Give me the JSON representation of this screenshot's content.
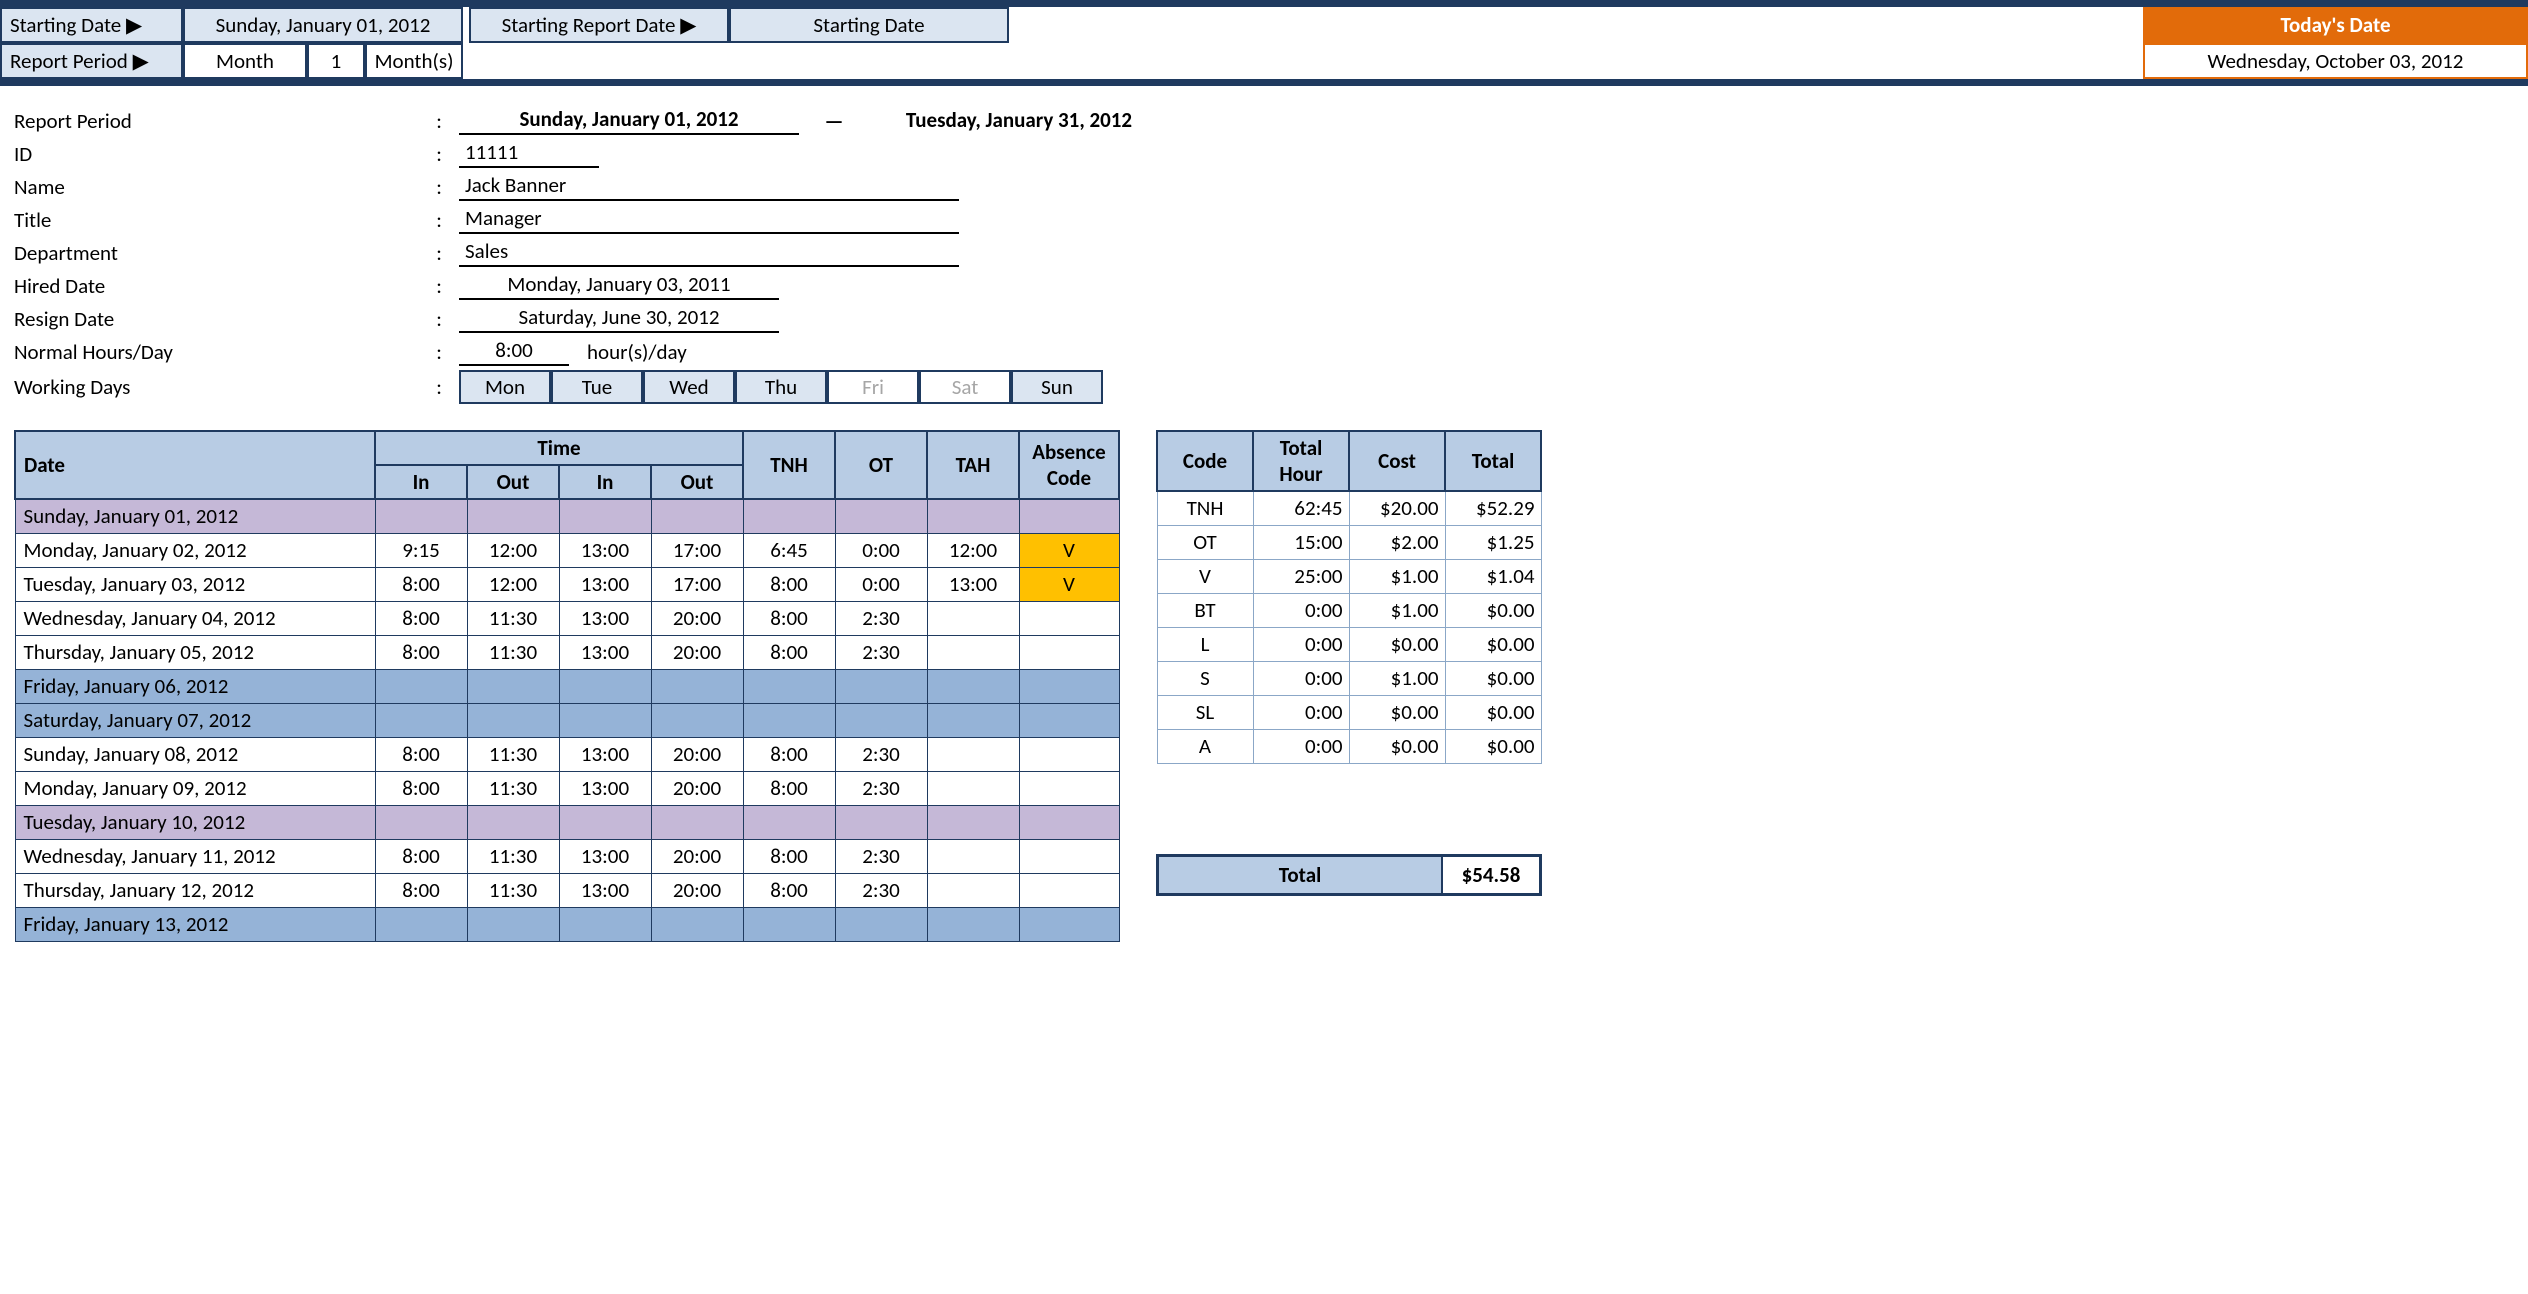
{
  "header": {
    "starting_date_label": "Starting Date ▶",
    "starting_date_value": "Sunday, January 01, 2012",
    "report_period_label": "Report Period ▶",
    "report_unit": "Month",
    "report_count": "1",
    "report_units": "Month(s)",
    "starting_report_label": "Starting Report Date ▶",
    "starting_report_value": "Starting Date",
    "todays_date_label": "Today's Date",
    "todays_date_value": "Wednesday, October 03, 2012"
  },
  "info": {
    "report_period_label": "Report Period",
    "report_start": "Sunday, January 01, 2012",
    "report_dash": "—",
    "report_end": "Tuesday, January 31, 2012",
    "id_label": "ID",
    "id_value": "11111",
    "name_label": "Name",
    "name_value": "Jack Banner",
    "title_label": "Title",
    "title_value": "Manager",
    "dept_label": "Department",
    "dept_value": "Sales",
    "hired_label": "Hired Date",
    "hired_value": "Monday, January 03, 2011",
    "resign_label": "Resign Date",
    "resign_value": "Saturday, June 30, 2012",
    "normal_label": "Normal Hours/Day",
    "normal_value": "8:00",
    "normal_unit": "hour(s)/day",
    "working_label": "Working Days",
    "days": [
      "Mon",
      "Tue",
      "Wed",
      "Thu",
      "Fri",
      "Sat",
      "Sun"
    ],
    "days_off": [
      false,
      false,
      false,
      false,
      true,
      true,
      false
    ]
  },
  "timesheet": {
    "headers": {
      "date": "Date",
      "time": "Time",
      "in": "In",
      "out": "Out",
      "tnh": "TNH",
      "ot": "OT",
      "tah": "TAH",
      "abs": "Absence Code"
    },
    "rows": [
      {
        "date": "Sunday, January 01, 2012",
        "in1": "",
        "out1": "",
        "in2": "",
        "out2": "",
        "tnh": "",
        "ot": "",
        "tah": "",
        "abs": "",
        "style": "purple"
      },
      {
        "date": "Monday, January 02, 2012",
        "in1": "9:15",
        "out1": "12:00",
        "in2": "13:00",
        "out2": "17:00",
        "tnh": "6:45",
        "ot": "0:00",
        "tah": "12:00",
        "abs": "V",
        "style": ""
      },
      {
        "date": "Tuesday, January 03, 2012",
        "in1": "8:00",
        "out1": "12:00",
        "in2": "13:00",
        "out2": "17:00",
        "tnh": "8:00",
        "ot": "0:00",
        "tah": "13:00",
        "abs": "V",
        "style": ""
      },
      {
        "date": "Wednesday, January 04, 2012",
        "in1": "8:00",
        "out1": "11:30",
        "in2": "13:00",
        "out2": "20:00",
        "tnh": "8:00",
        "ot": "2:30",
        "tah": "",
        "abs": "",
        "style": ""
      },
      {
        "date": "Thursday, January 05, 2012",
        "in1": "8:00",
        "out1": "11:30",
        "in2": "13:00",
        "out2": "20:00",
        "tnh": "8:00",
        "ot": "2:30",
        "tah": "",
        "abs": "",
        "style": ""
      },
      {
        "date": "Friday, January 06, 2012",
        "in1": "",
        "out1": "",
        "in2": "",
        "out2": "",
        "tnh": "",
        "ot": "",
        "tah": "",
        "abs": "",
        "style": "blue"
      },
      {
        "date": "Saturday, January 07, 2012",
        "in1": "",
        "out1": "",
        "in2": "",
        "out2": "",
        "tnh": "",
        "ot": "",
        "tah": "",
        "abs": "",
        "style": "blue"
      },
      {
        "date": "Sunday, January 08, 2012",
        "in1": "8:00",
        "out1": "11:30",
        "in2": "13:00",
        "out2": "20:00",
        "tnh": "8:00",
        "ot": "2:30",
        "tah": "",
        "abs": "",
        "style": ""
      },
      {
        "date": "Monday, January 09, 2012",
        "in1": "8:00",
        "out1": "11:30",
        "in2": "13:00",
        "out2": "20:00",
        "tnh": "8:00",
        "ot": "2:30",
        "tah": "",
        "abs": "",
        "style": ""
      },
      {
        "date": "Tuesday, January 10, 2012",
        "in1": "",
        "out1": "",
        "in2": "",
        "out2": "",
        "tnh": "",
        "ot": "",
        "tah": "",
        "abs": "",
        "style": "purple"
      },
      {
        "date": "Wednesday, January 11, 2012",
        "in1": "8:00",
        "out1": "11:30",
        "in2": "13:00",
        "out2": "20:00",
        "tnh": "8:00",
        "ot": "2:30",
        "tah": "",
        "abs": "",
        "style": ""
      },
      {
        "date": "Thursday, January 12, 2012",
        "in1": "8:00",
        "out1": "11:30",
        "in2": "13:00",
        "out2": "20:00",
        "tnh": "8:00",
        "ot": "2:30",
        "tah": "",
        "abs": "",
        "style": ""
      },
      {
        "date": "Friday, January 13, 2012",
        "in1": "",
        "out1": "",
        "in2": "",
        "out2": "",
        "tnh": "",
        "ot": "",
        "tah": "",
        "abs": "",
        "style": "blue"
      }
    ]
  },
  "summary": {
    "headers": {
      "code": "Code",
      "total_hour": "Total Hour",
      "cost": "Cost",
      "total": "Total"
    },
    "rows": [
      {
        "code": "TNH",
        "hour": "62:45",
        "cost": "$20.00",
        "total": "$52.29"
      },
      {
        "code": "OT",
        "hour": "15:00",
        "cost": "$2.00",
        "total": "$1.25"
      },
      {
        "code": "V",
        "hour": "25:00",
        "cost": "$1.00",
        "total": "$1.04"
      },
      {
        "code": "BT",
        "hour": "0:00",
        "cost": "$1.00",
        "total": "$0.00"
      },
      {
        "code": "L",
        "hour": "0:00",
        "cost": "$0.00",
        "total": "$0.00"
      },
      {
        "code": "S",
        "hour": "0:00",
        "cost": "$1.00",
        "total": "$0.00"
      },
      {
        "code": "SL",
        "hour": "0:00",
        "cost": "$0.00",
        "total": "$0.00"
      },
      {
        "code": "A",
        "hour": "0:00",
        "cost": "$0.00",
        "total": "$0.00"
      }
    ],
    "grand_label": "Total",
    "grand_total": "$54.58"
  }
}
